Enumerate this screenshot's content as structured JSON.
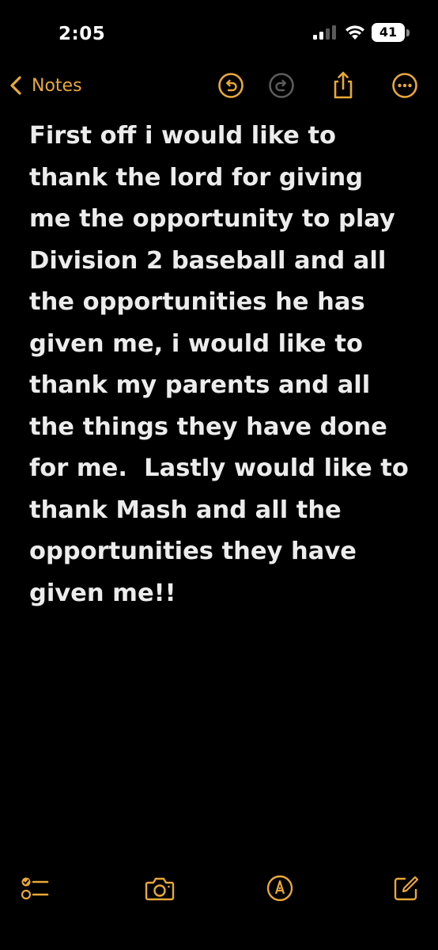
{
  "status_bar": {
    "time": "2:05",
    "battery_level": "41"
  },
  "nav": {
    "back_label": "Notes",
    "accent_color": "#e8a83a",
    "icons": [
      "chevron-left-icon",
      "undo-icon",
      "redo-icon",
      "share-icon",
      "more-icon"
    ]
  },
  "note": {
    "text": "First off i would like to thank the lord for giving me the opportunity to play Division 2 baseball and all the opportunities he has given me, i would like to thank my parents and all the things they have done for me.  Lastly would like to thank Mash and all the opportunities they have given me!!"
  },
  "toolbar": {
    "icons": [
      "checklist-icon",
      "camera-icon",
      "markup-icon",
      "compose-icon"
    ]
  }
}
